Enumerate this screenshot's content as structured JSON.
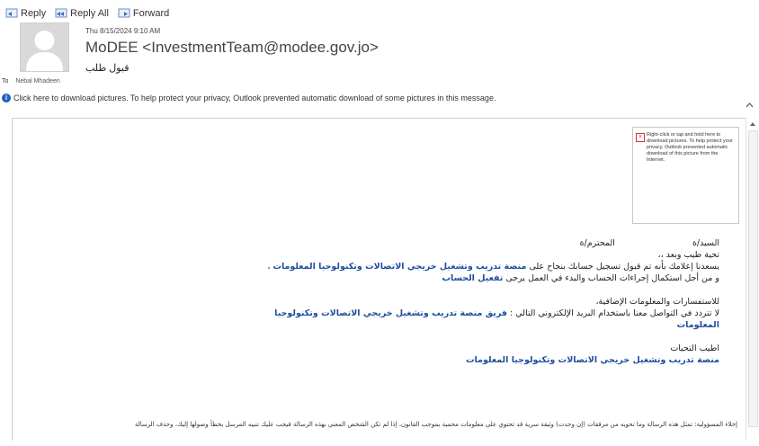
{
  "toolbar": {
    "reply": "Reply",
    "reply_all": "Reply All",
    "forward": "Forward"
  },
  "header": {
    "date": "Thu 8/15/2024 9:10 AM",
    "sender": "MoDEE <InvestmentTeam@modee.gov.jo>",
    "subject": "قبول طلب",
    "to_label": "To",
    "to_name": "Nebal Mhadeen"
  },
  "info_bar": {
    "text": "Click here to download pictures. To help protect your privacy, Outlook prevented automatic download of some pictures in this message."
  },
  "image_placeholder": {
    "text": "Right-click or tap and hold here to download pictures. To help protect your privacy, Outlook prevented automatic download of this picture from the Internet."
  },
  "body": {
    "salutation_a": "السيد/ة",
    "salutation_b": "المحترم/ة",
    "greeting": "تحية طيب وبعد ،،",
    "line1_a": "يسعدنا إعلامك بأنه تم قبول تسجيل حسابك بنجاح على",
    "line1_link": "منصة تدريب وتشغيل خريجي الاتصالات وتكنولوجيا المعلومات",
    "line1_b": "،",
    "line2_a": "و من أجل استكمال إجراءات الحساب والبدء في العمل يرجى",
    "line2_link": "تفعيل الحساب",
    "inquiries": "للاستفسارات والمعلومات الإضافية،",
    "contact_a": "لا تتردد في التواصل معنا باستخدام البريد الإلكتروني التالي :",
    "contact_link": "فريق منصة تدريب وتشغيل خريجي الاتصالات وتكنولوجيا المعلومات",
    "regards": "اطيب التحيات",
    "signature": "منصة تدريب وتشغيل خريجي الاتصالات وتكنولوجيا المعلومات"
  },
  "disclaimer": "إخلاء المسؤولية: تمثل هذه الرسالة وما تحويه من مرفقات (إن وجدت) وثيقة سرية قد تحتوي على معلومات محمية بموجب القانون، إذا لم تكن الشخص المعني بهذه الرسالة فيجب عليك تنبيه المرسل بخطأ وصولها إليك، وحذف الرسالة",
  "colors": {
    "link": "#1f4e9c",
    "info_icon": "#1f5fbf"
  }
}
